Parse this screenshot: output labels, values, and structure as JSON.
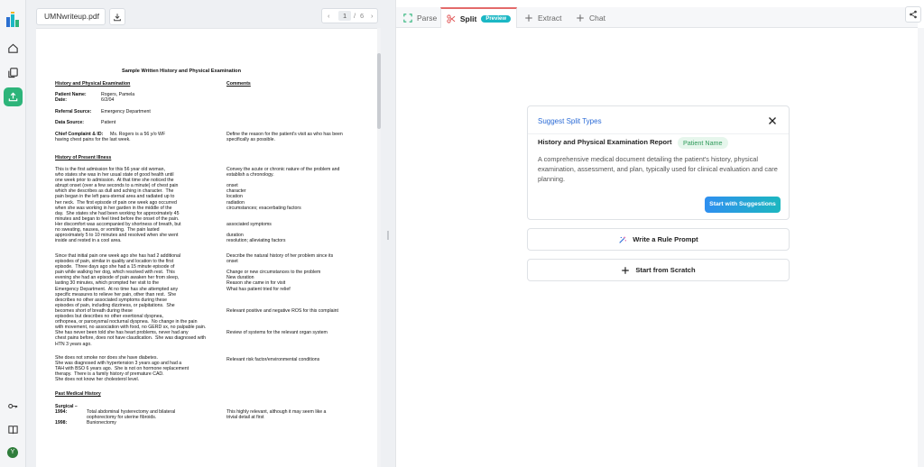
{
  "document": {
    "filename": "UMNwriteup.pdf",
    "pager": {
      "prev": "‹",
      "current": "1",
      "sep": "/",
      "total": "6",
      "next": "›"
    },
    "page": {
      "title": "Sample Written History and Physical Examination",
      "heading_left": "History and Physical Examination",
      "heading_right": "Comments",
      "patient_name_label": "Patient Name:",
      "patient_name_value": "Rogers, Pamela",
      "date_label": "Date:",
      "date_value": "6/2/04",
      "referral_label": "Referral Source:",
      "referral_value": "Emergency Department",
      "data_source_label": "Data Source:",
      "data_source_value": "Patient",
      "cc_label": "Chief Complaint & ID:",
      "cc_text_1": "Ms. Rogers is a 56 y/o WF",
      "cc_text_2": "having chest pains for the last week.",
      "cc_comment_1": "Define the reason for the patient's visit as who has been",
      "cc_comment_2": "specifically as possible.",
      "hpi_heading": "History of Present Illness",
      "hpi_p1": [
        "This is the first admission for this 56 year old woman,",
        "who states she was in her usual state of good health until",
        "one week prior to admission.  At that time she noticed the",
        "abrupt onset (over a few seconds to a minute) of chest pain",
        "which she describes as dull and aching in character.  The",
        "pain began in the left para-sternal area and radiated up to",
        "her neck.  The first episode of pain one week ago occurred",
        "when she was working in her garden in the middle of the",
        "day.  She states she had been working for approximately 45",
        "minutes and began to feel tired before the onset of the pain.",
        "Her discomfort was accompanied by shortness of breath, but",
        "no sweating, nausea, or vomiting.  The pain lasted",
        "approximately 5 to 10 minutes and resolved when she went",
        "inside and rested in a cool area."
      ],
      "hpi_p1_comments": [
        "Convey the acute or chronic nature of the problem and",
        "establish a chronology.",
        "",
        "onset",
        "character",
        "location",
        "radiation",
        "circumstances; exacerbating factors",
        "",
        "",
        "associated symptoms",
        "",
        "duration",
        "resolution; alleviating factors"
      ],
      "hpi_p2": [
        "Since that initial pain one week ago she has had 2 additional",
        "episodes of pain, similar in quality and location to the first",
        "episode.  Three days ago she had a 15 minute episode of",
        "pain while walking her dog, which resolved with rest.  This",
        "evening she had an episode of pain awaken her from sleep,",
        "lasting 30 minutes, which prompted her visit to the",
        "Emergency Department.  At no time has she attempted any",
        "specific measures to relieve her pain, other than rest.  She",
        "describes no other associated symptoms during these",
        "episodes of pain, including dizziness, or palpitations.  She",
        "becomes short of breath during these",
        "episodes but describes no other exertional dyspnea,",
        "orthopnea, or paroxysmal nocturnal dyspnea.  No change in the pain",
        "with movement, no association with food, no GERD sx, no palpable pain.",
        "She has never been told she has heart problems, never had any",
        "chest pains before, does not have claudication.  She was diagnosed with",
        "HTN 3 years ago."
      ],
      "hpi_p2_comments": [
        "Describe the natural history of her problem since its",
        "onset",
        "",
        "Change or new circumstances to the problem",
        "New duration",
        "Reason she came in for visit",
        "What has patient tried for relief",
        "",
        "",
        "",
        "Relevant positive and negative ROS for this complaint",
        "",
        "",
        "",
        "Review of systems for the relevant organ system",
        "",
        ""
      ],
      "hpi_p3": [
        "She does not smoke nor does she have diabetes.",
        "She was diagnosed with hypertension 3 years ago and had a",
        "TAH with BSO 6 years ago.  She is not on hormone replacement",
        "therapy.  There is a family history of premature CAD.",
        "She does not know her cholesterol level."
      ],
      "hpi_p3_comment": "Relevant risk factor/environmental conditions",
      "pmh_heading": "Past Medical History",
      "surgical_label": "Surgical –",
      "s1_year": "1994:",
      "s1_text_1": "Total abdominal hysterectomy and bilateral",
      "s1_text_2": "oophorectomy for uterine fibroids.",
      "s2_year": "1998:",
      "s2_text": "Bunionectomy",
      "s_comment_1": "This highly relevant, although it may seem like a",
      "s_comment_2": "trivial detail at first"
    }
  },
  "tabs": [
    {
      "label": "Parse",
      "icon": "scan-icon"
    },
    {
      "label": "Split",
      "icon": "scissors-icon",
      "badge": "Preview"
    },
    {
      "label": "Extract",
      "icon": "plus-icon"
    },
    {
      "label": "Chat",
      "icon": "plus-icon"
    }
  ],
  "suggest": {
    "title": "Suggest Split Types",
    "result_name": "History and Physical Examination Report",
    "result_tag": "Patient Name",
    "description": "A comprehensive medical document detailing the patient's history, physical examination, assessment, and plan, typically used for clinical evaluation and care planning.",
    "start_button": "Start with Suggestions"
  },
  "actions": {
    "rule_prompt": "Write a Rule Prompt",
    "from_scratch": "Start from Scratch"
  },
  "avatar": "Y",
  "colors": {
    "accent_green": "#2db47a",
    "tab_active_border": "#e36a6a",
    "badge": "#1bb7c4",
    "link_blue": "#2b6bd6"
  }
}
